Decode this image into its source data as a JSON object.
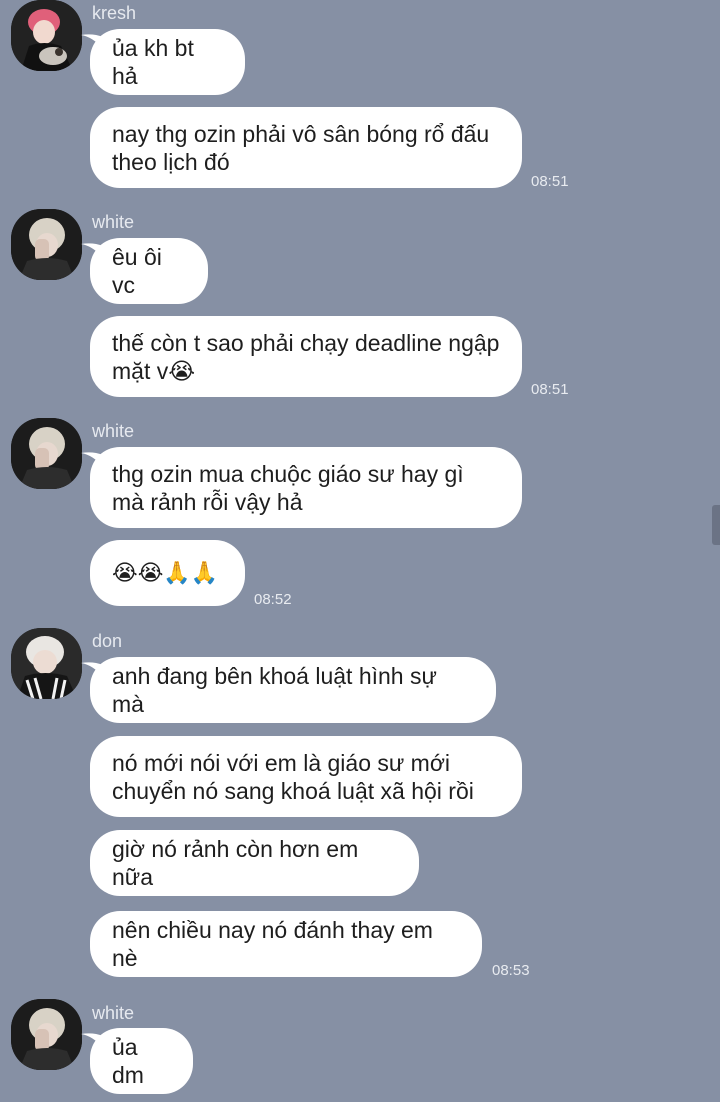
{
  "groups": [
    {
      "sender": "kresh",
      "messages": [
        {
          "text": "ủa kh bt hả"
        },
        {
          "text": "nay thg ozin phải vô sân bóng rổ đấu\ntheo lịch đó",
          "time": "08:51"
        }
      ]
    },
    {
      "sender": "white",
      "messages": [
        {
          "text": "êu ôi vc"
        },
        {
          "text": "thế còn t sao phải chạy deadline ngập\nmặt v😭",
          "time": "08:51"
        }
      ]
    },
    {
      "sender": "white",
      "messages": [
        {
          "text": "thg ozin mua chuộc giáo sư hay gì\nmà rảnh rỗi vậy hả"
        },
        {
          "text": "😭😭🙏🙏",
          "time": "08:52"
        }
      ]
    },
    {
      "sender": "don",
      "messages": [
        {
          "text": "anh đang bên khoá luật hình sự mà"
        },
        {
          "text": "nó mới nói với em là giáo sư mới\nchuyển nó sang khoá luật xã hội rồi"
        },
        {
          "text": "giờ nó rảnh còn hơn em nữa"
        },
        {
          "text": "nên chiều nay nó đánh thay em nè",
          "time": "08:53"
        }
      ]
    },
    {
      "sender": "white",
      "messages": [
        {
          "text": "ủa dm"
        }
      ]
    }
  ],
  "colors": {
    "background": "#8690a4",
    "bubble": "#ffffff",
    "kresh_hair": "#e0607a"
  }
}
